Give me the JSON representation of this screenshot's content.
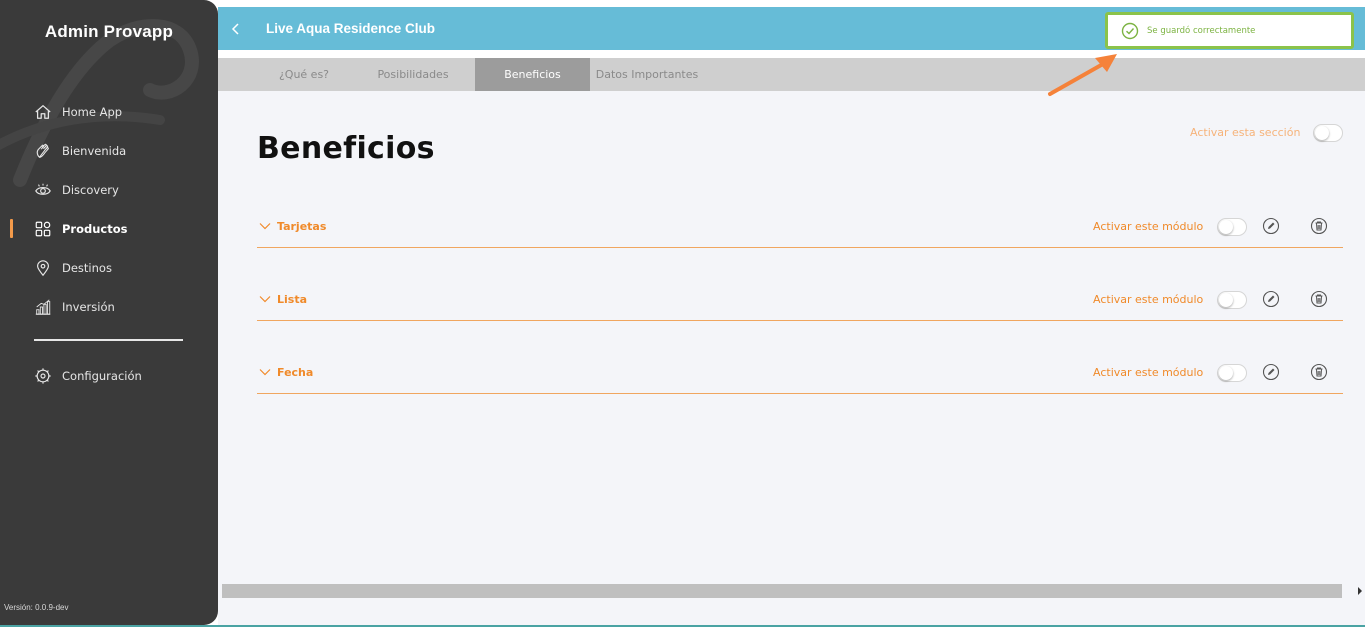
{
  "sidebar": {
    "brand": "Admin Provapp",
    "items": [
      {
        "label": "Home App",
        "icon": "home-icon"
      },
      {
        "label": "Bienvenida",
        "icon": "waving-hand-icon"
      },
      {
        "label": "Discovery",
        "icon": "eye-icon"
      },
      {
        "label": "Productos",
        "icon": "grid-icon",
        "active": true
      },
      {
        "label": "Destinos",
        "icon": "location-pin-icon"
      },
      {
        "label": "Inversión",
        "icon": "bar-chart-icon"
      }
    ],
    "config": {
      "label": "Configuración",
      "icon": "gear-icon"
    },
    "version": "Versión: 0.0.9-dev"
  },
  "header": {
    "title": "Live Aqua Residence Club",
    "back_icon": "chevron-left-icon"
  },
  "tabs": [
    {
      "label": "¿Qué es?"
    },
    {
      "label": "Posibilidades"
    },
    {
      "label": "Beneficios",
      "active": true
    },
    {
      "label": "Datos Importantes"
    }
  ],
  "main": {
    "title": "Beneficios",
    "section_toggle_label": "Activar esta sección",
    "section_active": false,
    "modules": [
      {
        "name": "Tarjetas",
        "toggle_label": "Activar este módulo",
        "active": false
      },
      {
        "name": "Lista",
        "toggle_label": "Activar este módulo",
        "active": false
      },
      {
        "name": "Fecha",
        "toggle_label": "Activar este módulo",
        "active": false
      }
    ]
  },
  "toast": {
    "message": "Se guardó correctamente",
    "icon": "check-circle-icon",
    "color": "#8bc34a"
  },
  "colors": {
    "sidebar": "#3a3a3a",
    "header": "#66bcd7",
    "accent": "#f08a2a",
    "active_tab": "#9c9c9c"
  }
}
